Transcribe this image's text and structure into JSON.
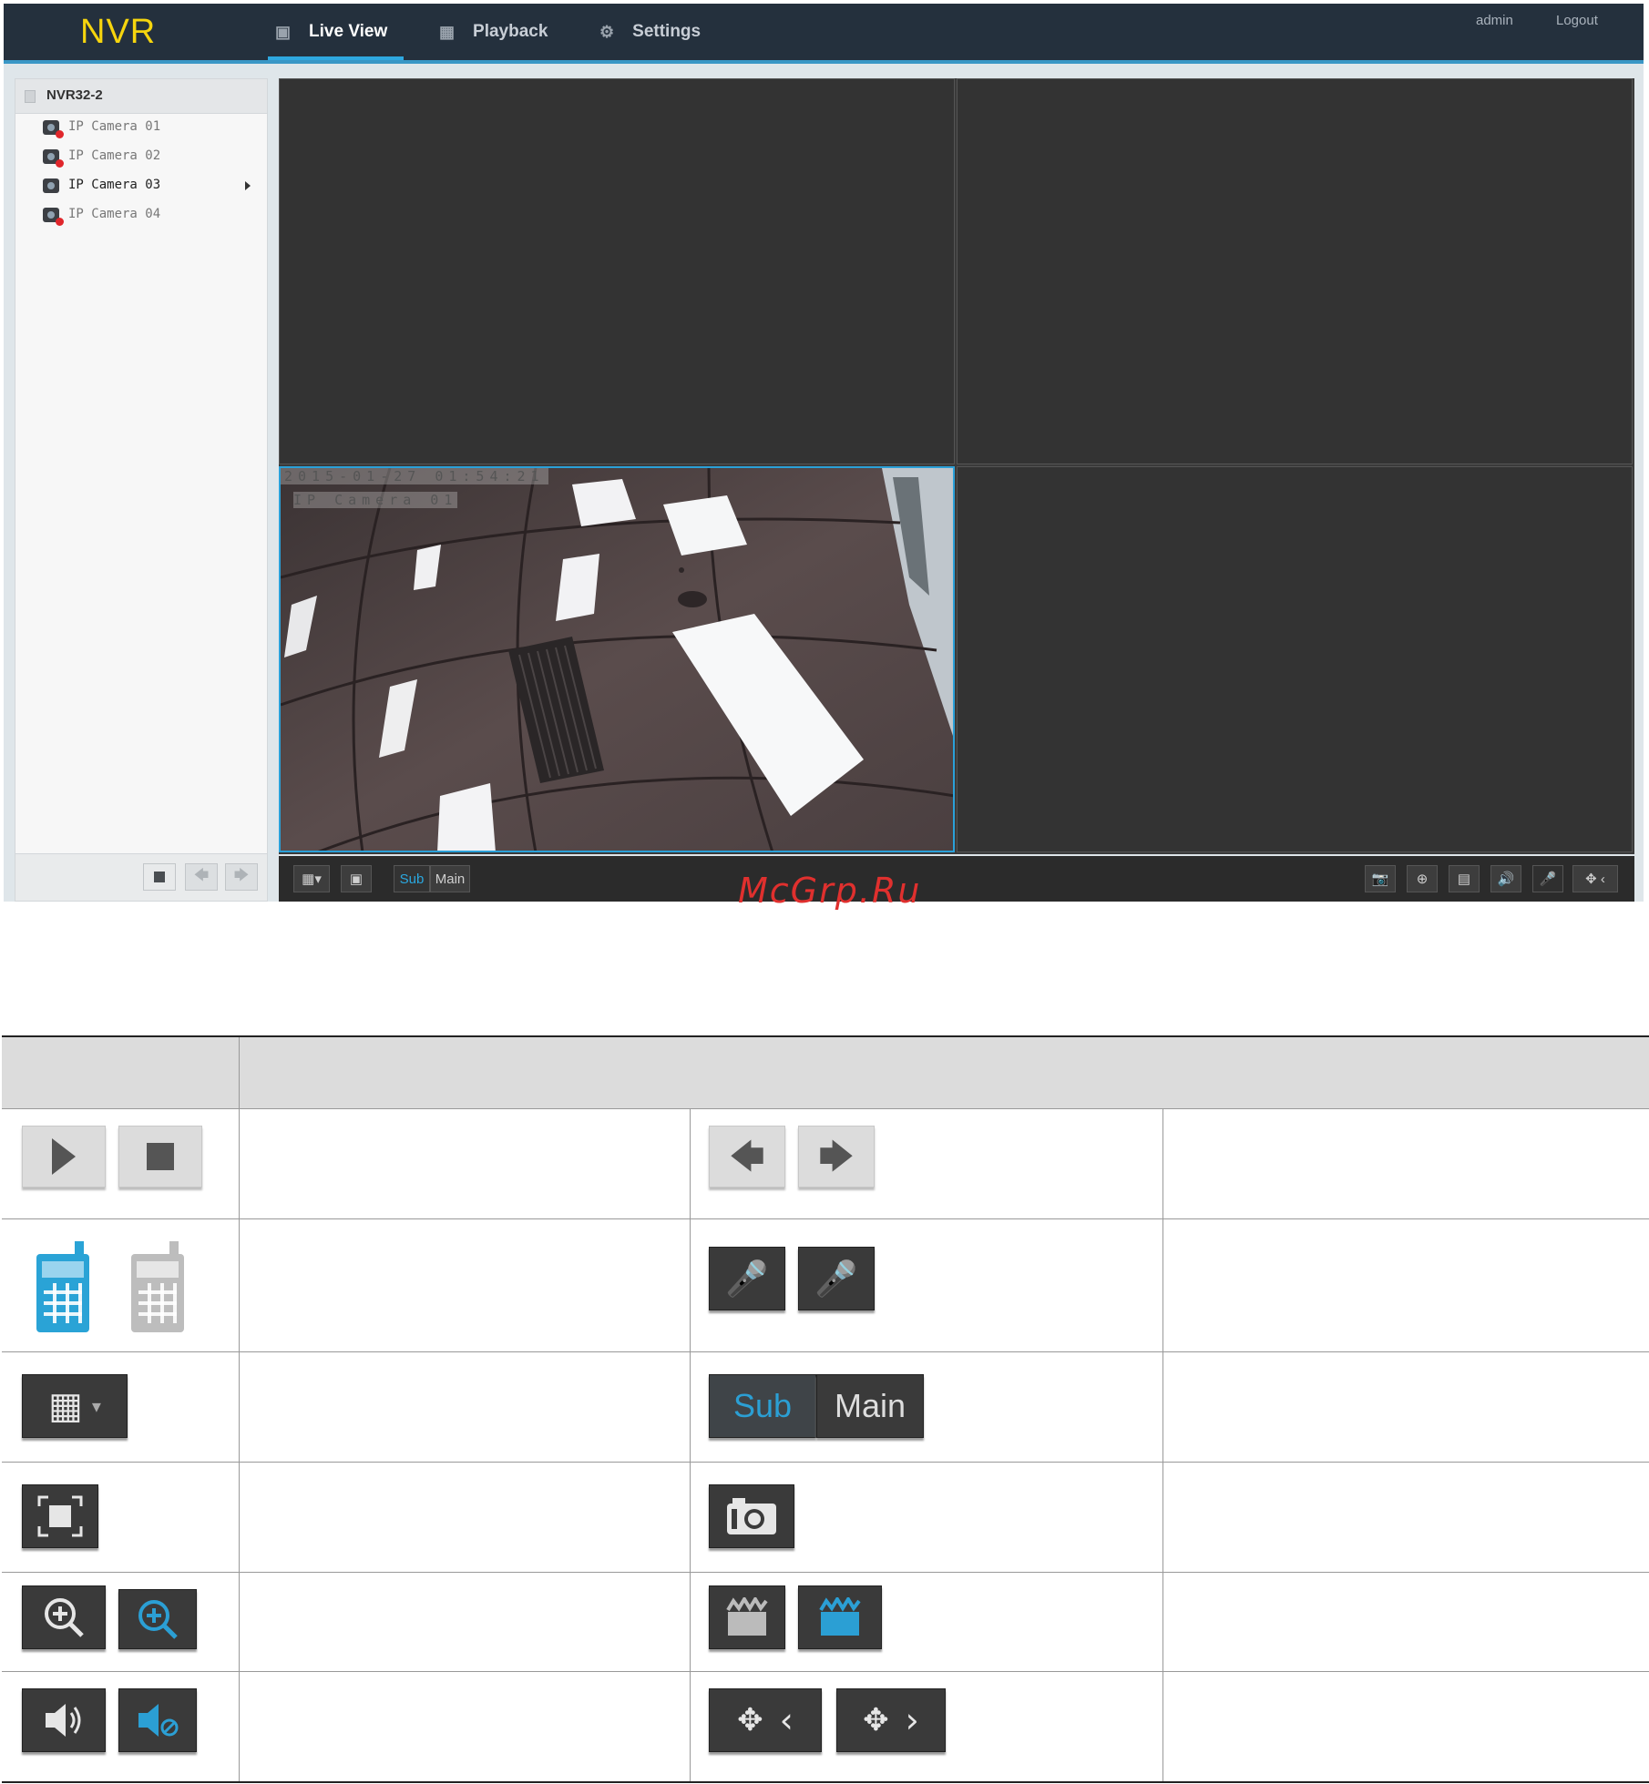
{
  "app": {
    "logo": "NVR",
    "nav": [
      {
        "label": "Live View",
        "icon": "monitor-icon",
        "active": true
      },
      {
        "label": "Playback",
        "icon": "film-icon",
        "active": false
      },
      {
        "label": "Settings",
        "icon": "gear-icon",
        "active": false
      }
    ],
    "user": {
      "name": "admin",
      "logout": "Logout"
    },
    "accent_color": "#2aa8e0",
    "logo_color": "#f6d50e"
  },
  "sidebar": {
    "root": "NVR32-2",
    "cameras": [
      {
        "label": "IP Camera 01",
        "status": "offline"
      },
      {
        "label": "IP Camera 02",
        "status": "offline"
      },
      {
        "label": "IP Camera 03",
        "status": "online",
        "selected": true
      },
      {
        "label": "IP Camera 04",
        "status": "offline"
      }
    ],
    "buttons": [
      "stop-icon",
      "arrow-left-icon",
      "arrow-right-icon"
    ]
  },
  "live": {
    "osd_time": "2015-01-27 01:54:21",
    "osd_name": "IP Camera 01",
    "toolbar": {
      "stream_sub": "Sub",
      "stream_main": "Main",
      "icons": [
        "layout-grid-icon",
        "fullscreen-icon",
        "snapshot-icon",
        "zoom-icon",
        "record-icon",
        "volume-icon",
        "mic-icon",
        "ptz-icon"
      ]
    }
  },
  "watermark": "McGrp.Ru",
  "legend_table": {
    "rows": [
      {
        "left_icons": [
          "play-icon",
          "stop-icon"
        ],
        "right_icons": [
          "arrow-left-icon",
          "arrow-right-icon"
        ]
      },
      {
        "left_icons": [
          "intercom-on-icon",
          "intercom-off-icon"
        ],
        "right_icons": [
          "mic-on-icon",
          "mic-off-icon"
        ]
      },
      {
        "left_icons": [
          "layout-grid-icon"
        ],
        "right_icons": [
          "stream-sub-main-icon"
        ],
        "sub": "Sub",
        "main": "Main"
      },
      {
        "left_icons": [
          "fullscreen-icon"
        ],
        "right_icons": [
          "snapshot-icon"
        ]
      },
      {
        "left_icons": [
          "zoom-icon",
          "zoom-active-icon"
        ],
        "right_icons": [
          "record-icon",
          "record-active-icon"
        ]
      },
      {
        "left_icons": [
          "volume-icon",
          "mute-icon"
        ],
        "right_icons": [
          "ptz-collapse-icon",
          "ptz-expand-icon"
        ]
      }
    ]
  }
}
